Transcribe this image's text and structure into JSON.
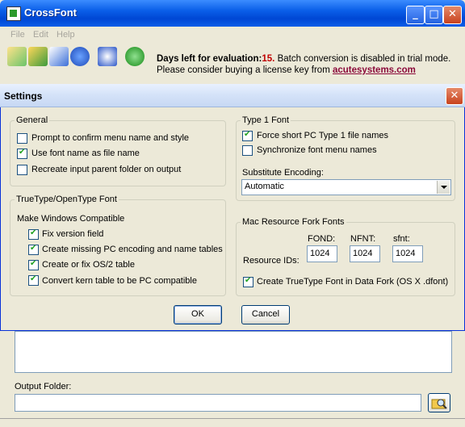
{
  "app": {
    "title": "CrossFont",
    "window_controls": [
      "minimize-icon",
      "maximize-icon",
      "close-icon"
    ],
    "menu": [
      "File",
      "Edit",
      "Help"
    ],
    "toolbar_icons": [
      "add-files-icon",
      "add-folder-icon",
      "convert-icon",
      "info-icon",
      "undo-icon",
      "help-icon"
    ],
    "eval_message": {
      "prefix": "Days left for evaluation:",
      "days": "15.",
      "line1_rest": "Batch conversion is disabled in trial mode.",
      "line2_prefix": "Please consider buying a license key from",
      "link": "acutesystems.com"
    },
    "output_folder_label": "Output Folder:",
    "output_folder_value": ""
  },
  "dialog": {
    "title": "Settings",
    "general": {
      "legend": "General",
      "options": [
        {
          "label": "Prompt to confirm menu name and style",
          "checked": false
        },
        {
          "label": "Use font name as file name",
          "checked": true
        },
        {
          "label": "Recreate input parent folder on output",
          "checked": false
        }
      ]
    },
    "truetype": {
      "legend": "TrueType/OpenType Font",
      "subheading": "Make Windows Compatible",
      "options": [
        {
          "label": "Fix version field",
          "checked": true
        },
        {
          "label": "Create missing PC encoding and name tables",
          "checked": true
        },
        {
          "label": "Create or fix OS/2 table",
          "checked": true
        },
        {
          "label": "Convert kern table to be PC compatible",
          "checked": true
        }
      ]
    },
    "type1": {
      "legend": "Type 1 Font",
      "options": [
        {
          "label": "Force short PC Type 1 file names",
          "checked": true
        },
        {
          "label": "Synchronize font menu names",
          "checked": false
        }
      ],
      "encoding_label": "Substitute Encoding:",
      "encoding_value": "Automatic"
    },
    "mac": {
      "legend": "Mac Resource Fork Fonts",
      "ids_label": "Resource IDs:",
      "fields": [
        {
          "label": "FOND:",
          "value": "1024"
        },
        {
          "label": "NFNT:",
          "value": "1024"
        },
        {
          "label": "sfnt:",
          "value": "1024"
        }
      ],
      "dfont_option": {
        "label": "Create TrueType Font in Data Fork (OS X .dfont)",
        "checked": true
      }
    },
    "ok_label": "OK",
    "cancel_label": "Cancel"
  },
  "colors": {
    "title_blue": "#0a5ee8",
    "eval_days": "#c00000",
    "link": "#8b0a3a"
  }
}
